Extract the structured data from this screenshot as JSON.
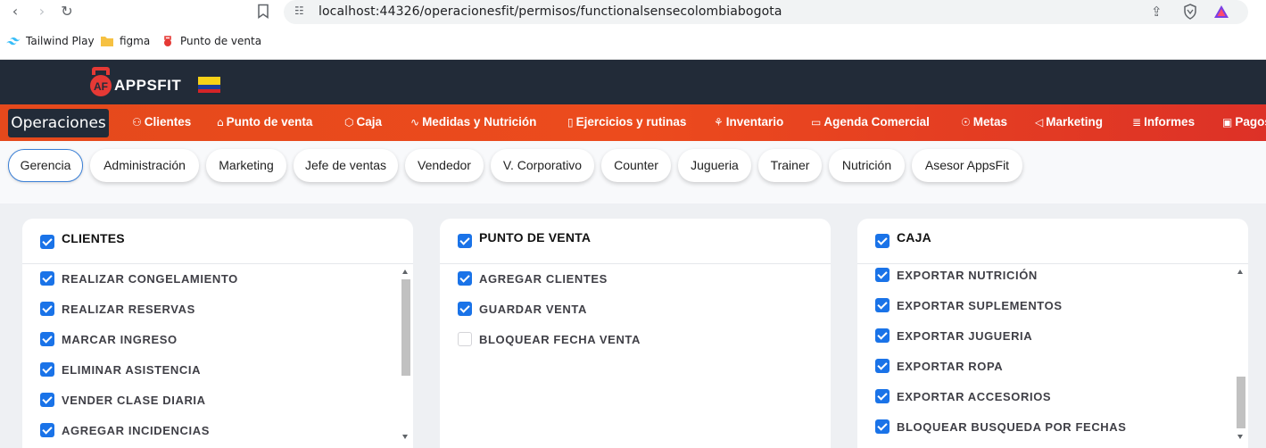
{
  "browser": {
    "url": "localhost:44326/operacionesfit/permisos/functionalsensecolombiabogota",
    "bookmarks": [
      {
        "label": "Tailwind Play"
      },
      {
        "label": "figma"
      },
      {
        "label": "Punto de venta"
      }
    ]
  },
  "app": {
    "logo_text": "APPSFIT",
    "logo_badge": "AF"
  },
  "modules": {
    "active": "Operaciones",
    "items": [
      {
        "label": "Clientes",
        "icon": "users-icon"
      },
      {
        "label": "Punto de venta",
        "icon": "basket-icon"
      },
      {
        "label": "Caja",
        "icon": "box-icon"
      },
      {
        "label": "Medidas y Nutrición",
        "icon": "pulse-icon"
      },
      {
        "label": "Ejercicios y rutinas",
        "icon": "phone-icon"
      },
      {
        "label": "Inventario",
        "icon": "cubes-icon"
      },
      {
        "label": "Agenda Comercial",
        "icon": "card-icon"
      },
      {
        "label": "Metas",
        "icon": "bulb-icon"
      },
      {
        "label": "Marketing",
        "icon": "megaphone-icon"
      },
      {
        "label": "Informes",
        "icon": "report-icon"
      },
      {
        "label": "Pagos",
        "icon": "payment-icon"
      }
    ]
  },
  "roles": [
    {
      "label": "Gerencia",
      "active": true
    },
    {
      "label": "Administración"
    },
    {
      "label": "Marketing"
    },
    {
      "label": "Jefe de ventas"
    },
    {
      "label": "Vendedor"
    },
    {
      "label": "V. Corporativo"
    },
    {
      "label": "Counter"
    },
    {
      "label": "Jugueria"
    },
    {
      "label": "Trainer"
    },
    {
      "label": "Nutrición"
    },
    {
      "label": "Asesor AppsFit"
    }
  ],
  "panels": [
    {
      "title": "CLIENTES",
      "checked": true,
      "items": [
        {
          "label": "REALIZAR CONGELAMIENTO",
          "checked": true
        },
        {
          "label": "REALIZAR RESERVAS",
          "checked": true
        },
        {
          "label": "MARCAR INGRESO",
          "checked": true
        },
        {
          "label": "ELIMINAR ASISTENCIA",
          "checked": true
        },
        {
          "label": "VENDER CLASE DIARIA",
          "checked": true
        },
        {
          "label": "AGREGAR INCIDENCIAS",
          "checked": true
        }
      ]
    },
    {
      "title": "PUNTO DE VENTA",
      "checked": true,
      "items": [
        {
          "label": "AGREGAR CLIENTES",
          "checked": true
        },
        {
          "label": "GUARDAR VENTA",
          "checked": true
        },
        {
          "label": "BLOQUEAR FECHA VENTA",
          "checked": false
        }
      ]
    },
    {
      "title": "CAJA",
      "checked": true,
      "items": [
        {
          "label": "EXPORTAR NUTRICIÓN",
          "checked": true
        },
        {
          "label": "EXPORTAR SUPLEMENTOS",
          "checked": true
        },
        {
          "label": "EXPORTAR JUGUERIA",
          "checked": true
        },
        {
          "label": "EXPORTAR ROPA",
          "checked": true
        },
        {
          "label": "EXPORTAR ACCESORIOS",
          "checked": true
        },
        {
          "label": "BLOQUEAR BUSQUEDA POR FECHAS",
          "checked": true
        }
      ]
    }
  ],
  "colors": {
    "header_bg": "#222b38",
    "module_bar": "#ec4b1d",
    "checkbox": "#1a73e8"
  }
}
